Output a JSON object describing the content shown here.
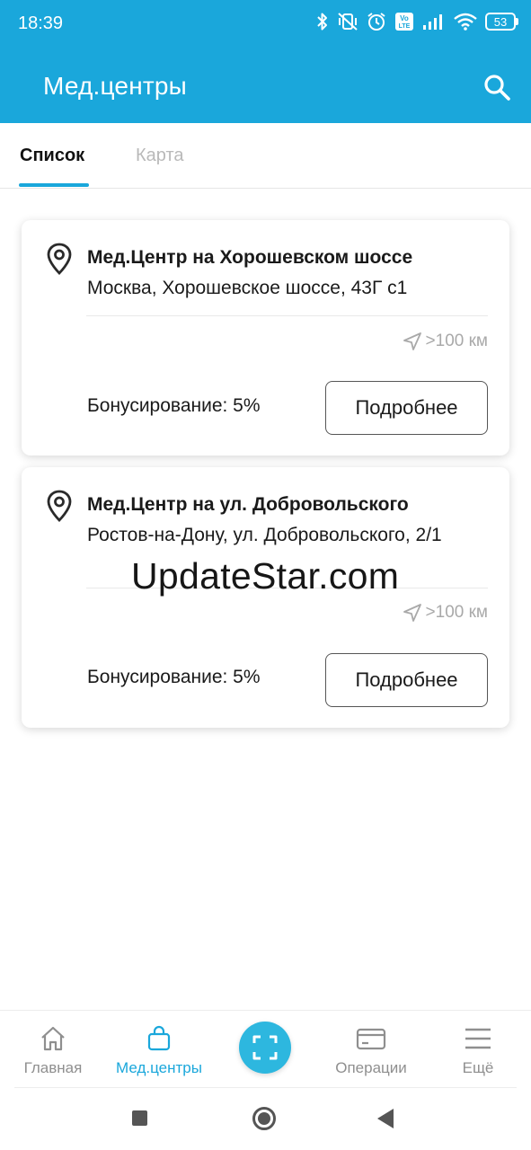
{
  "status_bar": {
    "time": "18:39",
    "battery": "53",
    "icons": [
      "bluetooth-icon",
      "vibrate-off-icon",
      "alarm-icon",
      "volte-icon",
      "signal-icon",
      "wifi-icon",
      "battery-icon"
    ]
  },
  "header": {
    "title": "Мед.центры",
    "search_icon": "search-icon",
    "background": "#1aa7db"
  },
  "tabs": [
    {
      "label": "Список",
      "active": true
    },
    {
      "label": "Карта",
      "active": false
    }
  ],
  "centers": [
    {
      "name": "Мед.Центр на Хорошевском шоссе",
      "address": "Москва, Хорошевское шоссе, 43Г с1",
      "distance": ">100 км",
      "bonus": "Бонусирование: 5%",
      "button": "Подробнее"
    },
    {
      "name": "Мед.Центр на ул. Добровольского",
      "address": "Ростов-на-Дону,  ул. Добровольского, 2/1",
      "distance": ">100 км",
      "bonus": "Бонусирование: 5%",
      "button": "Подробнее"
    }
  ],
  "watermark": "UpdateStar.com",
  "bottom_nav": {
    "items": [
      {
        "label": "Главная",
        "icon": "home-icon",
        "active": false
      },
      {
        "label": "Мед.центры",
        "icon": "bag-icon",
        "active": true
      },
      {
        "label": "",
        "icon": "scan-icon",
        "active": false
      },
      {
        "label": "Операции",
        "icon": "card-icon",
        "active": false
      },
      {
        "label": "Ещё",
        "icon": "menu-icon",
        "active": false
      }
    ],
    "accent": "#1aa7db"
  },
  "system_nav": [
    "recent-apps-icon",
    "home-icon",
    "back-icon"
  ]
}
